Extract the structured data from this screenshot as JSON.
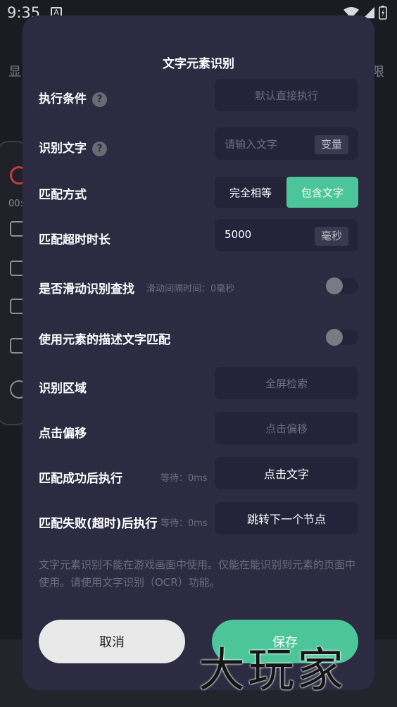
{
  "status_bar": {
    "time": "9:35",
    "notification_letter": "A"
  },
  "background": {
    "left_text": "显",
    "right_text": "限",
    "timer": "00:"
  },
  "dialog": {
    "title": "文字元素识别",
    "rows": {
      "exec_condition": {
        "label": "执行条件",
        "help": "?",
        "placeholder": "默认直接执行"
      },
      "recognize_text": {
        "label": "识别文字",
        "help": "?",
        "placeholder": "请输入文字",
        "suffix": "变量"
      },
      "match_mode": {
        "label": "匹配方式",
        "options": [
          "完全相等",
          "包含文字"
        ],
        "selected": "包含文字"
      },
      "match_timeout": {
        "label": "匹配超时时长",
        "value": "5000",
        "unit": "毫秒"
      },
      "swipe_search": {
        "label": "是否滑动识别查找",
        "hint": "滑动间隔时间：0毫秒",
        "enabled": false
      },
      "desc_match": {
        "label": "使用元素的描述文字匹配",
        "enabled": false
      },
      "region": {
        "label": "识别区域",
        "placeholder": "全屏检索"
      },
      "click_offset": {
        "label": "点击偏移",
        "placeholder": "点击偏移"
      },
      "on_success": {
        "label": "匹配成功后执行",
        "wait": "等待：0ms",
        "action": "点击文字"
      },
      "on_fail": {
        "label": "匹配失败(超时)后执行",
        "wait": "等待：0ms",
        "action": "跳转下一个节点"
      }
    },
    "note": "文字元素识别不能在游戏画面中使用。仅能在能识别到元素的页面中使用。请使用文字识别（OCR）功能。",
    "cancel_label": "取消",
    "save_label": "保存"
  },
  "watermark": "大玩家",
  "colors": {
    "dialog_bg": "#2c2b42",
    "field_bg": "#24233a",
    "accent": "#4cc59b"
  }
}
